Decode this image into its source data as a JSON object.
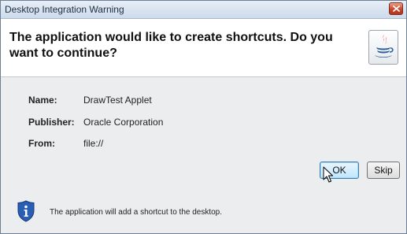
{
  "window": {
    "title": "Desktop Integration Warning",
    "close_icon": "close-icon"
  },
  "header": {
    "message": "The application would like to create shortcuts. Do you want to continue?",
    "logo_icon": "java-logo-icon"
  },
  "details": {
    "name_label": "Name:",
    "name_value": "DrawTest Applet",
    "publisher_label": "Publisher:",
    "publisher_value": "Oracle Corporation",
    "from_label": "From:",
    "from_value": "file://"
  },
  "buttons": {
    "ok_label": "OK",
    "skip_label": "Skip"
  },
  "footer": {
    "info_icon": "shield-info-icon",
    "text": "The application will add a shortcut to the desktop."
  },
  "colors": {
    "close_button": "#c8452c",
    "info_shield": "#2a5db4",
    "default_button_border": "#3c7fb1"
  }
}
